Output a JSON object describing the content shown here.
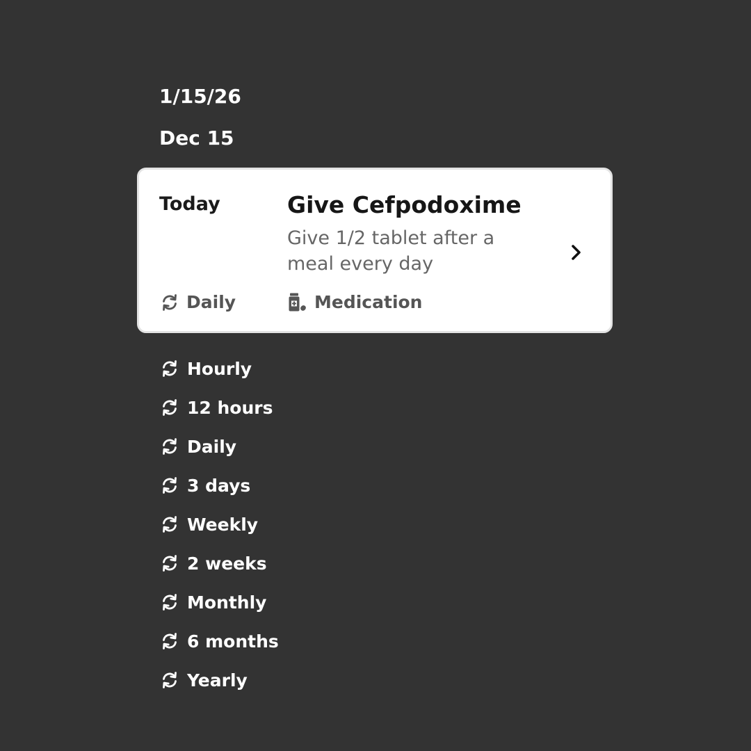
{
  "dates": {
    "primary": "1/15/26",
    "secondary": "Dec 15"
  },
  "card": {
    "when": "Today",
    "title": "Give Cefpodoxime",
    "description": "Give 1/2 tablet after a meal every day",
    "frequency": "Daily",
    "frequency_icon": "repeat-icon",
    "type": "Medication",
    "type_icon": "medication-icon",
    "action_icon": "chevron-right-icon"
  },
  "frequencies": [
    {
      "label": "Hourly",
      "icon": "repeat-icon"
    },
    {
      "label": "12 hours",
      "icon": "repeat-icon"
    },
    {
      "label": "Daily",
      "icon": "repeat-icon"
    },
    {
      "label": "3 days",
      "icon": "repeat-icon"
    },
    {
      "label": "Weekly",
      "icon": "repeat-icon"
    },
    {
      "label": "2 weeks",
      "icon": "repeat-icon"
    },
    {
      "label": "Monthly",
      "icon": "repeat-icon"
    },
    {
      "label": "6 months",
      "icon": "repeat-icon"
    },
    {
      "label": "Yearly",
      "icon": "repeat-icon"
    }
  ],
  "colors": {
    "background": "#333333",
    "card": "#ffffff",
    "text_primary": "#161616",
    "text_secondary": "#666666",
    "list_text": "#ffffff"
  }
}
